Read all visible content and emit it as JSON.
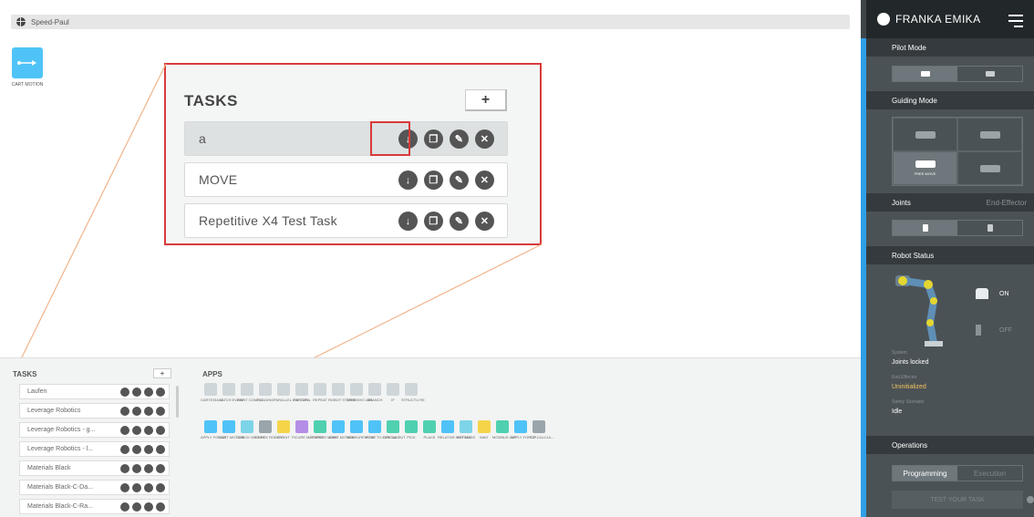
{
  "workspace": {
    "taskbar_title": "Speed-Paul",
    "timeline_app_label": "CART MOTION"
  },
  "callout": {
    "title": "TASKS",
    "add_label": "+",
    "rows": [
      {
        "name": "a"
      },
      {
        "name": "MOVE"
      },
      {
        "name": "Repetitive X4 Test Task"
      }
    ]
  },
  "tasks_panel": {
    "title": "TASKS",
    "add_label": "+",
    "rows": [
      "Laufen",
      "Leverage Robotics",
      "Leverage Robotics - g...",
      "Leverage Robotics - l...",
      "Materials Black",
      "Materials Black-C-Da...",
      "Materials Black-C-Ra..."
    ]
  },
  "apps_panel": {
    "title": "APPS",
    "row1": [
      {
        "label": "CARTESIA N...",
        "color": "#cfd6d9"
      },
      {
        "label": "CATCH EVENT",
        "color": "#cfd6d9"
      },
      {
        "label": "JOINT COMPLI...",
        "color": "#cfd6d9"
      },
      {
        "label": "LOGGING",
        "color": "#cfd6d9"
      },
      {
        "label": "PARALLEL EXECUTI...",
        "color": "#cfd6d9"
      },
      {
        "label": "PATTERN",
        "color": "#cfd6d9"
      },
      {
        "label": "REPEAT",
        "color": "#cfd6d9"
      },
      {
        "label": "ROBOT STATUS",
        "color": "#cfd6d9"
      },
      {
        "label": "THRESHO LDS",
        "color": "#cfd6d9"
      },
      {
        "label": "BRANCH",
        "color": "#cfd6d9"
      },
      {
        "label": "IF",
        "color": "#cfd6d9"
      },
      {
        "label": "STRUCTU RE",
        "color": "#cfd6d9"
      }
    ],
    "row2": [
      {
        "label": "APPLY FORCE",
        "color": "#4fc3f7"
      },
      {
        "label": "CART MOTION",
        "color": "#4fc3f7"
      },
      {
        "label": "CHECK WEIGHT",
        "color": "#7dd4e8"
      },
      {
        "label": "CHECK ROBOT...",
        "color": "#9aa5ab"
      },
      {
        "label": "EVENT",
        "color": "#f5d44a"
      },
      {
        "label": "FICURE MOTIONS",
        "color": "#b48ee6"
      },
      {
        "label": "GRIPPER MOVE",
        "color": "#4fd1b0"
      },
      {
        "label": "JOINT MOTION",
        "color": "#4fc3f7"
      },
      {
        "label": "MEASURE POSE",
        "color": "#4fc3f7"
      },
      {
        "label": "MOVE TO CONTACT",
        "color": "#4fc3f7"
      },
      {
        "label": "OPC UA OUT",
        "color": "#4fd1b0"
      },
      {
        "label": "PICK",
        "color": "#4fd1b0"
      },
      {
        "label": "PLACE",
        "color": "#4fd1b0"
      },
      {
        "label": "RELATIVE MOTION",
        "color": "#4fc3f7"
      },
      {
        "label": "SET MASS",
        "color": "#7dd4e8"
      },
      {
        "label": "WAIT",
        "color": "#f5d44a"
      },
      {
        "label": "MODBUS OUT",
        "color": "#4fd1b0"
      },
      {
        "label": "APPLY FORCE...",
        "color": "#4fc3f7"
      },
      {
        "label": "TCP CALCUL...",
        "color": "#9aa5ab"
      }
    ]
  },
  "sidebar": {
    "brand": "FRANKA EMIKA",
    "pilot_mode": "Pilot Mode",
    "guiding_mode": "Guiding Mode",
    "free_move": "FREE MOVE",
    "joints": "Joints",
    "end_effector": "End-Effector",
    "robot_status": "Robot Status",
    "on": "ON",
    "off": "OFF",
    "system_label": "System",
    "system_value": "Joints locked",
    "ee_label": "End Effector",
    "ee_value": "Uninitialized",
    "safety_label": "Safety Scenario",
    "safety_value": "Idle",
    "operations": "Operations",
    "tab_programming": "Programming",
    "tab_execution": "Execution",
    "test_button": "TEST YOUR TASK",
    "accent_color": "#2f9fe6",
    "warn_color": "#f3c35d"
  }
}
